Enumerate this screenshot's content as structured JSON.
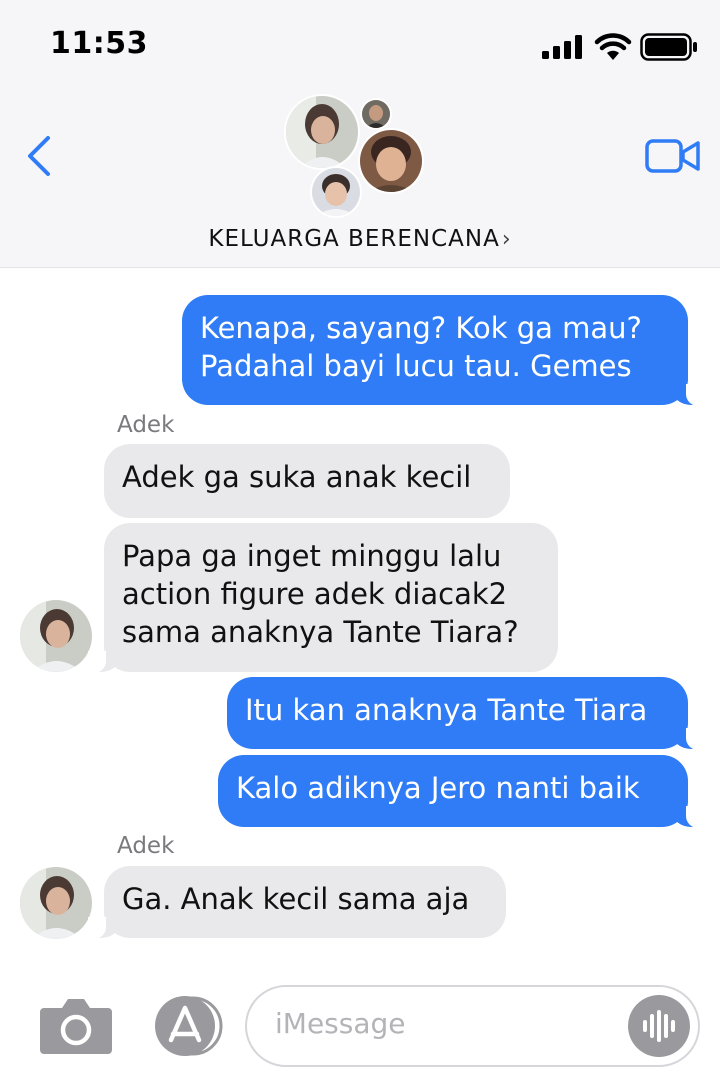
{
  "status_bar": {
    "time": "11:53"
  },
  "header": {
    "group_name": "KELUARGA BERENCANA",
    "chevron": "›",
    "icons": [
      "back-chevron-icon",
      "video-camera-icon",
      "signal-icon",
      "wifi-icon",
      "battery-icon"
    ]
  },
  "messages": [
    {
      "direction": "outgoing",
      "text": "Kenapa, sayang? Kok ga mau?\nPadahal bayi lucu tau. Gemes"
    },
    {
      "direction": "incoming",
      "sender": "Adek",
      "text": "Adek ga suka anak kecil"
    },
    {
      "direction": "incoming",
      "text": "Papa ga inget minggu lalu\naction figure adek diacak2\nsama anaknya Tante Tiara?"
    },
    {
      "direction": "outgoing",
      "text": "Itu kan anaknya Tante Tiara"
    },
    {
      "direction": "outgoing",
      "text": "Kalo adiknya Jero nanti baik"
    },
    {
      "direction": "incoming",
      "sender": "Adek",
      "text": "Ga. Anak kecil sama aja"
    }
  ],
  "composer": {
    "placeholder": "iMessage",
    "icons": [
      "camera-icon",
      "app-store-icon",
      "audio-waveform-icon"
    ]
  },
  "colors": {
    "outgoing_bubble": "#2f7cf6",
    "incoming_bubble": "#e9e9eb",
    "accent": "#2f7cf6"
  }
}
